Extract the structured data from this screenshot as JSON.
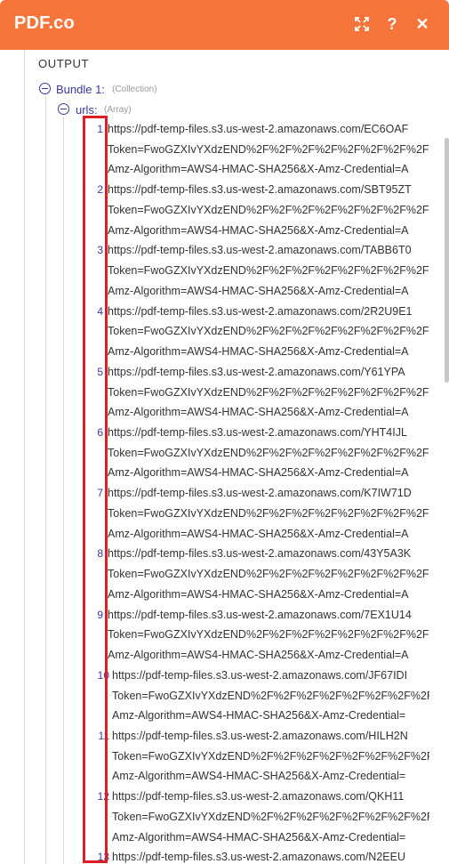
{
  "header": {
    "title": "PDF.co",
    "icons": [
      "expand-icon",
      "help-icon",
      "close-icon"
    ],
    "help_glyph": "?",
    "close_glyph": "✕",
    "color": "#f7753a"
  },
  "output": {
    "label": "OUTPUT",
    "bundle": {
      "label": "Bundle 1:",
      "type": "(Collection)"
    },
    "urls": {
      "label": "urls:",
      "type": "(Array)"
    },
    "items": [
      {
        "index": "1",
        "lines": [
          "https://pdf-temp-files.s3.us-west-2.amazonaws.com/EC6OAF",
          "Token=FwoGZXIvYXdzEND%2F%2F%2F%2F%2F%2F%2F%2F%2F",
          "Amz-Algorithm=AWS4-HMAC-SHA256&X-Amz-Credential=A"
        ]
      },
      {
        "index": "2",
        "lines": [
          "https://pdf-temp-files.s3.us-west-2.amazonaws.com/SBT95ZT",
          "Token=FwoGZXIvYXdzEND%2F%2F%2F%2F%2F%2F%2F%2F%2F",
          "Amz-Algorithm=AWS4-HMAC-SHA256&X-Amz-Credential=A"
        ]
      },
      {
        "index": "3",
        "lines": [
          "https://pdf-temp-files.s3.us-west-2.amazonaws.com/TABB6T0",
          "Token=FwoGZXIvYXdzEND%2F%2F%2F%2F%2F%2F%2F%2F%2F",
          "Amz-Algorithm=AWS4-HMAC-SHA256&X-Amz-Credential=A"
        ]
      },
      {
        "index": "4",
        "lines": [
          "https://pdf-temp-files.s3.us-west-2.amazonaws.com/2R2U9E1",
          "Token=FwoGZXIvYXdzEND%2F%2F%2F%2F%2F%2F%2F%2F%2F",
          "Amz-Algorithm=AWS4-HMAC-SHA256&X-Amz-Credential=A"
        ]
      },
      {
        "index": "5",
        "lines": [
          "https://pdf-temp-files.s3.us-west-2.amazonaws.com/Y61YPA",
          "Token=FwoGZXIvYXdzEND%2F%2F%2F%2F%2F%2F%2F%2F%2F",
          "Amz-Algorithm=AWS4-HMAC-SHA256&X-Amz-Credential=A"
        ]
      },
      {
        "index": "6",
        "lines": [
          "https://pdf-temp-files.s3.us-west-2.amazonaws.com/YHT4IJL",
          "Token=FwoGZXIvYXdzEND%2F%2F%2F%2F%2F%2F%2F%2F%2F",
          "Amz-Algorithm=AWS4-HMAC-SHA256&X-Amz-Credential=A"
        ]
      },
      {
        "index": "7",
        "lines": [
          "https://pdf-temp-files.s3.us-west-2.amazonaws.com/K7IW71D",
          "Token=FwoGZXIvYXdzEND%2F%2F%2F%2F%2F%2F%2F%2F%2F",
          "Amz-Algorithm=AWS4-HMAC-SHA256&X-Amz-Credential=A"
        ]
      },
      {
        "index": "8",
        "lines": [
          "https://pdf-temp-files.s3.us-west-2.amazonaws.com/43Y5A3K",
          "Token=FwoGZXIvYXdzEND%2F%2F%2F%2F%2F%2F%2F%2F%2F",
          "Amz-Algorithm=AWS4-HMAC-SHA256&X-Amz-Credential=A"
        ]
      },
      {
        "index": "9",
        "lines": [
          "https://pdf-temp-files.s3.us-west-2.amazonaws.com/7EX1U14",
          "Token=FwoGZXIvYXdzEND%2F%2F%2F%2F%2F%2F%2F%2F%2F",
          "Amz-Algorithm=AWS4-HMAC-SHA256&X-Amz-Credential=A"
        ]
      },
      {
        "index": "10",
        "lines": [
          "https://pdf-temp-files.s3.us-west-2.amazonaws.com/JF67IDI",
          "Token=FwoGZXIvYXdzEND%2F%2F%2F%2F%2F%2F%2F%2F%2F",
          "Amz-Algorithm=AWS4-HMAC-SHA256&X-Amz-Credential="
        ]
      },
      {
        "index": "11",
        "lines": [
          "https://pdf-temp-files.s3.us-west-2.amazonaws.com/HILH2N",
          "Token=FwoGZXIvYXdzEND%2F%2F%2F%2F%2F%2F%2F%2F%2F",
          "Amz-Algorithm=AWS4-HMAC-SHA256&X-Amz-Credential="
        ]
      },
      {
        "index": "12",
        "lines": [
          "https://pdf-temp-files.s3.us-west-2.amazonaws.com/QKH11",
          "Token=FwoGZXIvYXdzEND%2F%2F%2F%2F%2F%2F%2F%2F%2F",
          "Amz-Algorithm=AWS4-HMAC-SHA256&X-Amz-Credential="
        ]
      },
      {
        "index": "13",
        "lines": [
          "https://pdf-temp-files.s3.us-west-2.amazonaws.com/N2EEU"
        ]
      }
    ]
  },
  "highlight_color": "#dd1f25"
}
